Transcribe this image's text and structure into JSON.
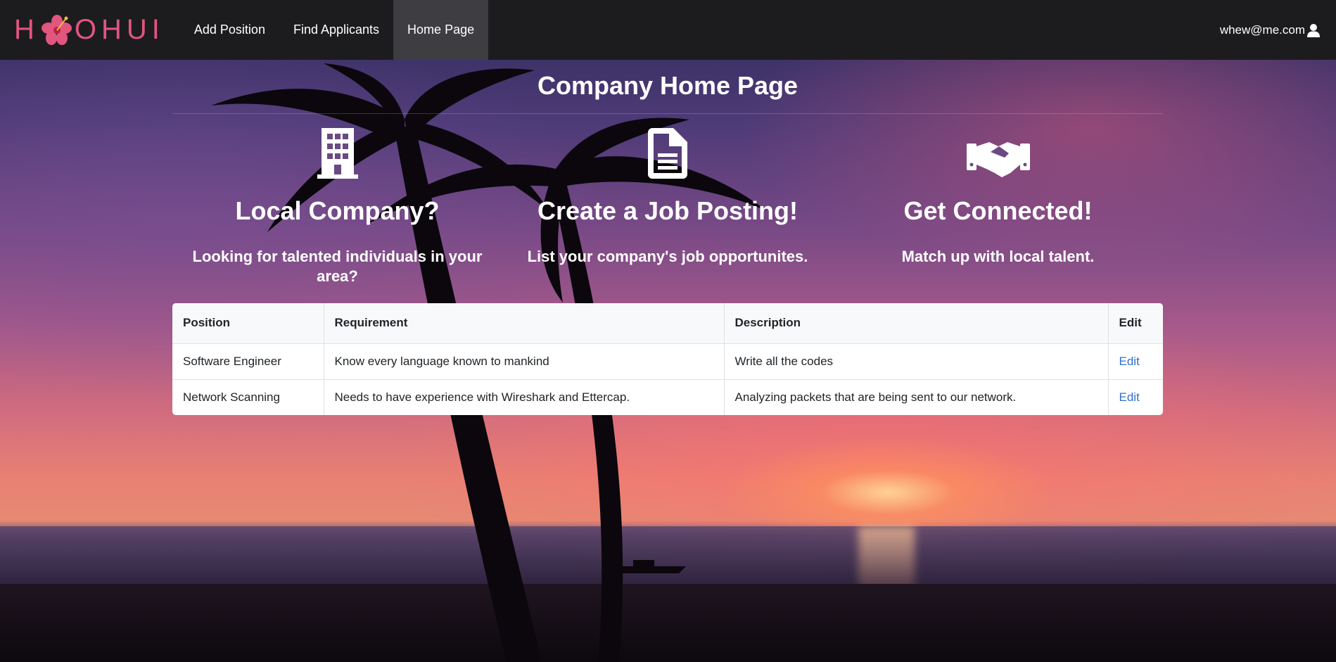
{
  "navbar": {
    "brand_left": "H",
    "brand_right": "OHUI",
    "brand_icon": "hibiscus-flower-icon",
    "links": [
      {
        "label": "Add Position",
        "active": false
      },
      {
        "label": "Find Applicants",
        "active": false
      },
      {
        "label": "Home Page",
        "active": true
      }
    ],
    "user_email": "whew@me.com",
    "user_icon": "user-icon"
  },
  "page": {
    "title": "Company Home Page"
  },
  "features": [
    {
      "icon": "building-icon",
      "heading": "Local Company?",
      "text": "Looking for talented individuals in your area?"
    },
    {
      "icon": "document-icon",
      "heading": "Create a Job Posting!",
      "text": "List your company's job opportunites."
    },
    {
      "icon": "handshake-icon",
      "heading": "Get Connected!",
      "text": "Match up with local talent."
    }
  ],
  "table": {
    "headers": [
      "Position",
      "Requirement",
      "Description",
      "Edit"
    ],
    "rows": [
      {
        "position": "Software Engineer",
        "requirement": "Know every language known to mankind",
        "description": "Write all the codes",
        "edit": "Edit"
      },
      {
        "position": "Network Scanning",
        "requirement": "Needs to have experience with Wireshark and Ettercap.",
        "description": "Analyzing packets that are being sent to our network.",
        "edit": "Edit"
      }
    ]
  },
  "colors": {
    "navbar_bg": "#1c1c1f",
    "active_nav_bg": "#3e3e42",
    "brand": "#e2557f",
    "link": "#2f6fcb"
  }
}
